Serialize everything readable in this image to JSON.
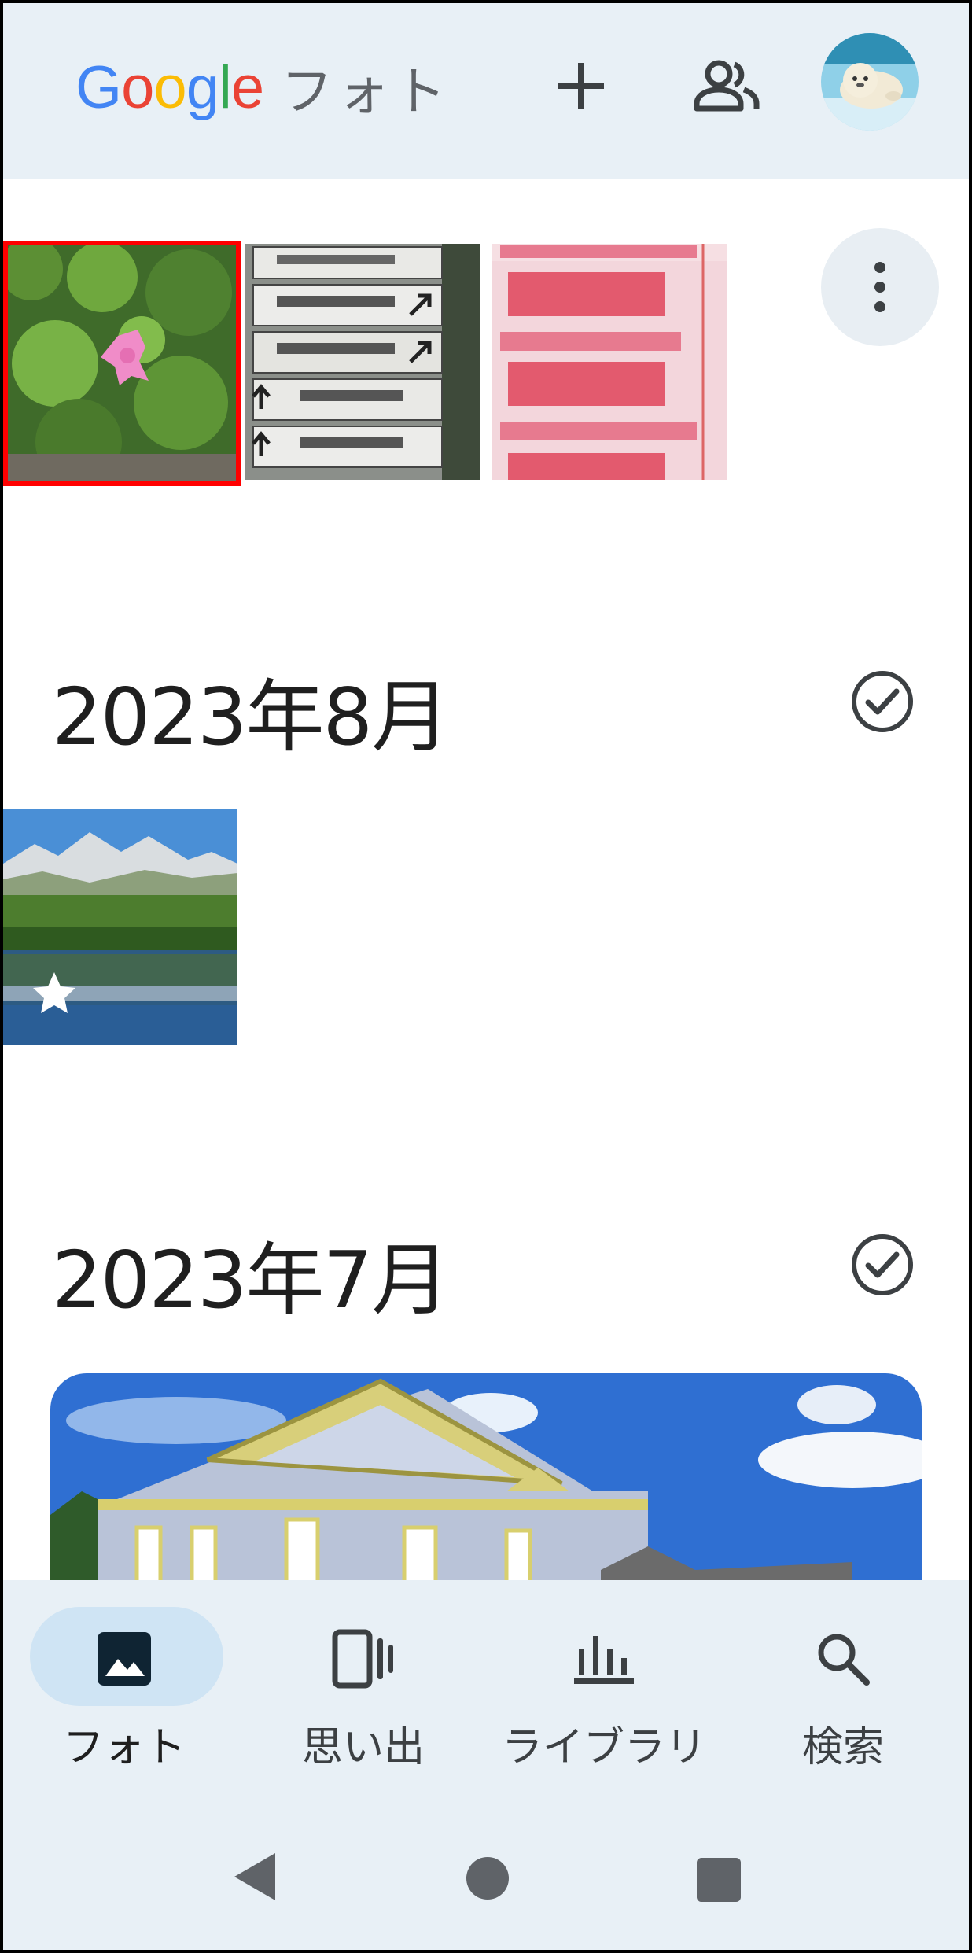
{
  "header": {
    "logo_letters": [
      "G",
      "o",
      "o",
      "g",
      "l",
      "e"
    ],
    "logo_colors": [
      "#4285f4",
      "#ea4335",
      "#fbbc05",
      "#4285f4",
      "#34a853",
      "#ea4335"
    ],
    "logo_suffix": "フォト",
    "add_icon": "plus-icon",
    "share_icon": "people-icon",
    "avatar": "seal-avatar"
  },
  "grid_top": {
    "photos": [
      {
        "name": "pink-azalea-photo",
        "selected": true
      },
      {
        "name": "shrine-signpost-photo",
        "selected": false
      },
      {
        "name": "price-flyer-photo",
        "selected": false
      }
    ],
    "more_icon": "more-vert-icon"
  },
  "sections": [
    {
      "title": "2023年8月",
      "check_icon": "check-circle-icon",
      "photos": [
        {
          "name": "mountain-lake-photo",
          "favorite": true
        }
      ]
    },
    {
      "title": "2023年7月",
      "check_icon": "check-circle-icon",
      "photos": [
        {
          "name": "western-building-photo",
          "favorite": false
        }
      ]
    }
  ],
  "nav": {
    "items": [
      {
        "label": "フォト",
        "icon": "photo-icon",
        "active": true
      },
      {
        "label": "思い出",
        "icon": "memories-icon",
        "active": false
      },
      {
        "label": "ライブラリ",
        "icon": "library-icon",
        "active": false
      },
      {
        "label": "検索",
        "icon": "search-icon",
        "active": false
      }
    ]
  },
  "colors": {
    "accent_pill": "#cfe4f4",
    "header_bg": "#e8f0f6",
    "selection_border": "#ff0000"
  }
}
